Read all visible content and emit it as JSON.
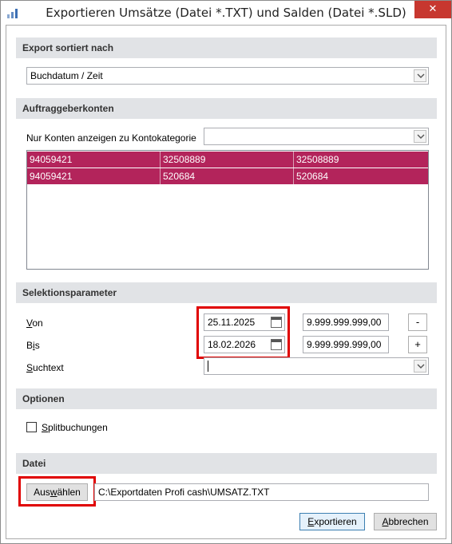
{
  "window": {
    "title": "Exportieren Umsätze (Datei *.TXT) und Salden (Datei *.SLD)",
    "close_glyph": "✕"
  },
  "sections": {
    "export": "Export sortiert nach",
    "accounts": "Auftraggeberkonten",
    "selection": "Selektionsparameter",
    "options": "Optionen",
    "file": "Datei"
  },
  "sort": {
    "value": "Buchdatum / Zeit"
  },
  "accounts": {
    "filter_label": "Nur Konten anzeigen zu Kontokategorie",
    "filter_value": "",
    "rows": [
      [
        "94059421",
        "32508889",
        "32508889"
      ],
      [
        "94059421",
        "520684",
        "520684"
      ]
    ],
    "row_color": "#b3245b"
  },
  "selection": {
    "from_label_u": "V",
    "from_label_rest": "on",
    "to_label_pre": "B",
    "to_label_u": "i",
    "to_label_rest": "s",
    "search_label_pre": "",
    "search_label_u": "S",
    "search_label_rest": "uchtext",
    "from_date": "25.11.2025",
    "to_date": "18.02.2026",
    "from_amount": "9.999.999.999,00",
    "to_amount": "9.999.999.999,00",
    "minus": "-",
    "plus": "+",
    "search_value": ""
  },
  "options": {
    "split_u": "S",
    "split_rest": "plitbuchungen",
    "split_checked": false
  },
  "file": {
    "choose_pre": "Aus",
    "choose_u": "w",
    "choose_rest": "ählen",
    "path": "C:\\Exportdaten Profi cash\\UMSATZ.TXT"
  },
  "footer": {
    "export_pre": "",
    "export_u": "E",
    "export_rest": "xportieren",
    "cancel_pre": "",
    "cancel_u": "A",
    "cancel_rest": "bbrechen"
  },
  "colors": {
    "accent_highlight": "#e00000",
    "section_bg": "#e1e3e6",
    "close_bg": "#c7372f"
  },
  "icons": {
    "app": "bar-chart-icon",
    "calendar": "calendar-icon",
    "dropdown": "chevron-down-icon"
  }
}
